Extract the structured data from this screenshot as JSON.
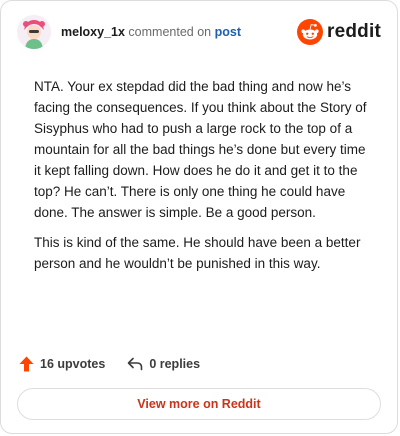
{
  "header": {
    "username": "meloxy_1x",
    "verb": "commented on",
    "post_link": "post",
    "brand": "reddit"
  },
  "comment": {
    "paragraphs": [
      "NTA. Your ex stepdad did the bad thing and now he’s facing the consequences. If you think about the Story of Sisyphus who had to push a large rock to the top of a mountain for all the bad things he’s done but every time it kept falling down. How does he do it and get it to the top? He can’t. There is only one thing he could have done. The answer is simple. Be a good person.",
      "This is kind of the same. He should have been a better person and he wouldn’t be punished in this way."
    ]
  },
  "actions": {
    "upvotes": "16 upvotes",
    "replies": "0 replies"
  },
  "cta": {
    "label": "View more on Reddit"
  },
  "colors": {
    "accent": "#ff4500",
    "link": "#1a5fb4",
    "cta_text": "#c8351a"
  },
  "icons": [
    "avatar",
    "reddit-logo-icon",
    "upvote-arrow-icon",
    "reply-icon"
  ]
}
